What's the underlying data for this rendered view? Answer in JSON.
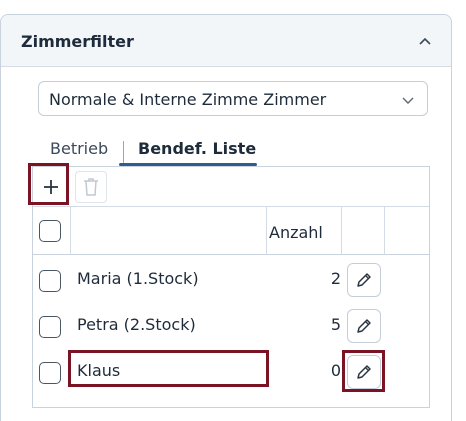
{
  "panel": {
    "title": "Zimmerfilter"
  },
  "filter_select": {
    "value": "Normale & Interne Zimme Zimmer"
  },
  "tabs": [
    {
      "label": "Betrieb",
      "active": false
    },
    {
      "label": "Bendef. Liste",
      "active": true
    }
  ],
  "table": {
    "columns": [
      "",
      "",
      "Anzahl",
      "",
      ""
    ],
    "rows": [
      {
        "name": "Maria (1.Stock)",
        "count": "2"
      },
      {
        "name": "Petra (2.Stock)",
        "count": "5"
      },
      {
        "name": "Klaus",
        "count": "0"
      }
    ]
  },
  "icons": {
    "collapse": "chevron-up-icon",
    "select": "chevron-down-icon",
    "add": "plus-icon",
    "delete": "trash-icon",
    "edit": "pencil-icon"
  },
  "colors": {
    "accent": "#2f5e8e",
    "highlight": "#7a1323",
    "border": "#c9d3de"
  }
}
